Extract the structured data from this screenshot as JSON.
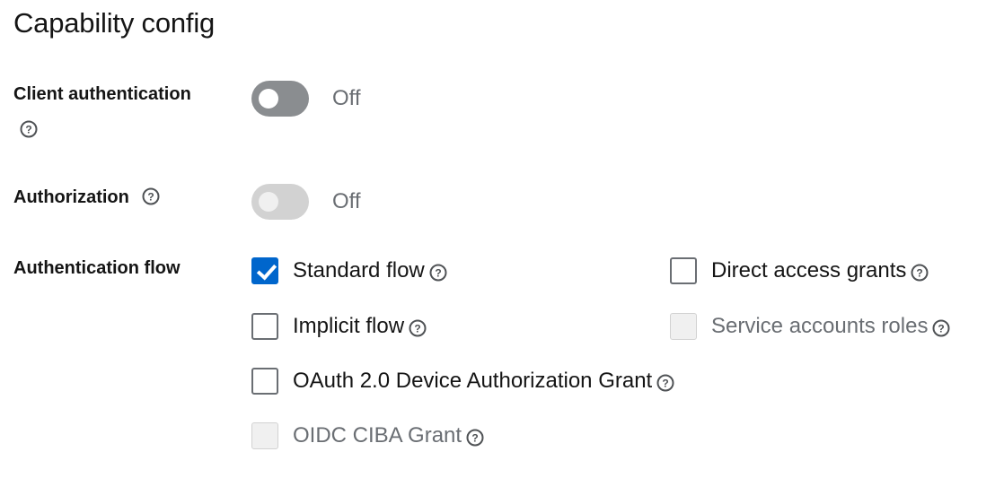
{
  "title": "Capability config",
  "client_authentication": {
    "label": "Client authentication",
    "state_text": "Off",
    "enabled": false
  },
  "authorization": {
    "label": "Authorization",
    "state_text": "Off",
    "enabled": false,
    "disabled": true
  },
  "authentication_flow": {
    "label": "Authentication flow",
    "options": [
      {
        "label": "Standard flow",
        "checked": true,
        "disabled": false
      },
      {
        "label": "Direct access grants",
        "checked": false,
        "disabled": false
      },
      {
        "label": "Implicit flow",
        "checked": false,
        "disabled": false
      },
      {
        "label": "Service accounts roles",
        "checked": false,
        "disabled": true
      },
      {
        "label": "OAuth 2.0 Device Authorization Grant",
        "checked": false,
        "disabled": false
      },
      {
        "label": "OIDC CIBA Grant",
        "checked": false,
        "disabled": true
      }
    ]
  },
  "icons": {
    "help": "question-circle-icon"
  },
  "colors": {
    "accent": "#0066cc",
    "switch_off": "#8a8d90",
    "switch_disabled": "#d2d2d2",
    "muted_text": "#6a6e73",
    "text": "#151515"
  }
}
